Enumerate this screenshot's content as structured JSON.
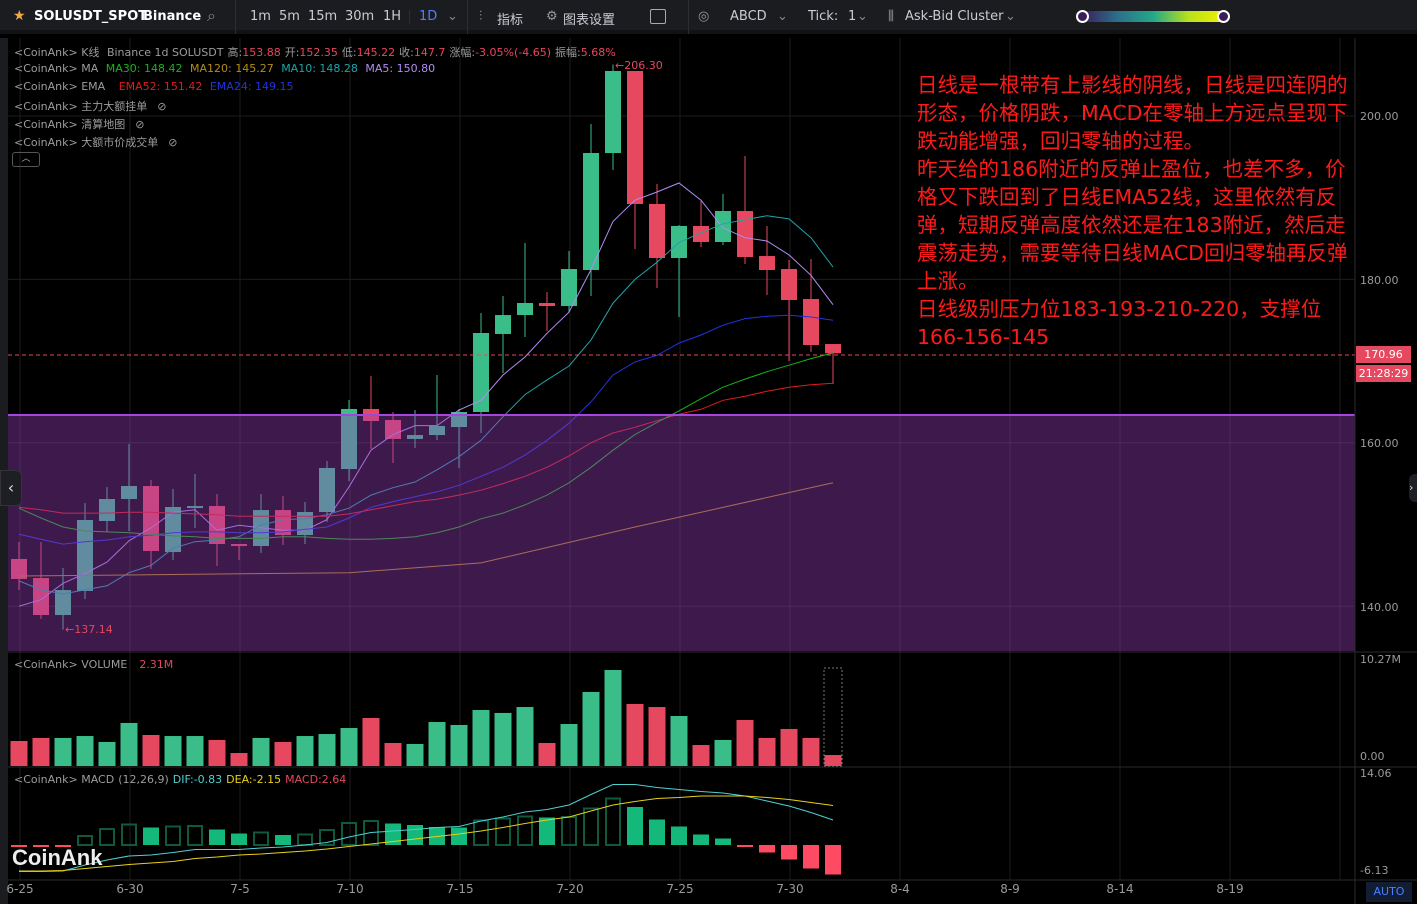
{
  "toolbar": {
    "symbol": "SOLUSDT_SPOT",
    "exchange": "Binance",
    "intervals": [
      "1m",
      "5m",
      "15m",
      "30m",
      "1H"
    ],
    "active_interval": "1D",
    "indicators_label": "指标",
    "chart_settings_label": "图表设置",
    "abcd_label": "ABCD",
    "tick_label": "Tick:",
    "tick_value": "1",
    "cluster_label": "Ask-Bid Cluster",
    "accent": "#4d7fff"
  },
  "legend": {
    "kline": {
      "prefix": "<CoinAnk> K线",
      "info": "Binance 1d SOLUSDT",
      "high_label": "高:",
      "high": "153.88",
      "open_label": "开:",
      "open": "152.35",
      "low_label": "低:",
      "low": "145.22",
      "close_label": "收:",
      "close": "147.7",
      "change_label": "涨幅:",
      "change": "-3.05%(-4.65)",
      "amplitude_label": "振幅:",
      "amplitude": "5.68%"
    },
    "ma": {
      "prefix": "<CoinAnk> MA",
      "items": [
        {
          "text": "MA30: 148.42",
          "color": "#17b417"
        },
        {
          "text": "MA120: 145.27",
          "color": "#b58b16"
        },
        {
          "text": "MA10: 148.28",
          "color": "#1fa3a8"
        },
        {
          "text": "MA5: 150.80",
          "color": "#b48cf2"
        }
      ]
    },
    "ema": {
      "prefix": "<CoinAnk> EMA",
      "items": [
        {
          "text": "EMA52: 151.42",
          "color": "#e21b1b"
        },
        {
          "text": "EMA24: 149.15",
          "color": "#2233e0"
        }
      ]
    },
    "hidden": [
      "<CoinAnk> 主力大额挂单",
      "<CoinAnk> 清算地图",
      "<CoinAnk> 大额市价成交单"
    ],
    "volume": {
      "prefix": "<CoinAnk> VOLUME",
      "value": "2.31M"
    },
    "macd": {
      "prefix": "<CoinAnk> MACD",
      "params": "(12,26,9)",
      "dif": "DIF:-0.83",
      "dea": "DEA:-2.15",
      "macd": "MACD:2.64"
    }
  },
  "axes": {
    "price_ticks": [
      "200.00",
      "180.00",
      "160.00",
      "140.00"
    ],
    "volume_ticks": [
      "10.27M",
      "0.00"
    ],
    "macd_ticks": [
      "14.06",
      "-6.13"
    ],
    "x_ticks": [
      "6-25",
      "6-30",
      "7-5",
      "7-10",
      "7-15",
      "7-20",
      "7-25",
      "7-30",
      "8-4",
      "8-9",
      "8-14",
      "8-19"
    ],
    "auto_label": "AUTO"
  },
  "current_price": "170.96",
  "countdown": "21:28:29",
  "markers": {
    "high": "←206.30",
    "low": "←137.14"
  },
  "watermark": "CoinAnk",
  "annotation": [
    "日线是一根带有上影线的阴线，日线是四连阴的",
    "形态，价格阴跌，MACD在零轴上方远点呈现下",
    "跌动能增强，回归零轴的过程。",
    "昨天给的186附近的反弹止盈位，也差不多，价",
    "格又下跌回到了日线EMA52线，这里依然有反",
    "弹，短期反弹高度依然还是在183附近，然后走",
    "震荡走势，需要等待日线MACD回归零轴再反弹",
    "上涨。",
    "日线级别压力位183-193-210-220，支撑位",
    "166-156-145"
  ],
  "colors": {
    "up": "#3bbd8a",
    "down": "#e5485f",
    "zone": "#a445e0",
    "note": "#ff1a1a"
  },
  "chart_data": {
    "type": "candlestick",
    "price_range": [
      136,
      208
    ],
    "zone": [
      137,
      164.5
    ],
    "candles": [
      [
        145.78,
        147.86,
        141.98,
        143.33
      ],
      [
        143.45,
        147.86,
        138.43,
        138.92
      ],
      [
        138.92,
        144.68,
        137.14,
        141.98
      ],
      [
        141.86,
        152.63,
        140.88,
        150.55
      ],
      [
        150.43,
        154.59,
        149.08,
        153.12
      ],
      [
        153.12,
        159.85,
        149.2,
        154.71
      ],
      [
        154.71,
        155.45,
        144.55,
        146.76
      ],
      [
        146.63,
        154.35,
        145.65,
        152.14
      ],
      [
        152.14,
        156.18,
        149.57,
        152.26
      ],
      [
        152.26,
        153.73,
        144.92,
        147.61
      ],
      [
        147.61,
        147.61,
        145.65,
        147.37
      ],
      [
        147.37,
        153.73,
        146.51,
        151.77
      ],
      [
        151.77,
        153.49,
        147.49,
        148.71
      ],
      [
        148.71,
        152.75,
        147.61,
        151.53
      ],
      [
        151.53,
        157.77,
        150.31,
        156.92
      ],
      [
        156.79,
        165.24,
        155.32,
        164.14
      ],
      [
        164.14,
        168.18,
        159.24,
        162.67
      ],
      [
        162.79,
        163.77,
        157.53,
        160.47
      ],
      [
        160.47,
        164.01,
        159.36,
        160.95
      ],
      [
        160.95,
        168.3,
        160.34,
        162.06
      ],
      [
        161.93,
        164.14,
        156.92,
        163.77
      ],
      [
        163.77,
        175.89,
        161.2,
        173.44
      ],
      [
        173.32,
        177.97,
        168.54,
        175.64
      ],
      [
        175.64,
        184.46,
        172.95,
        177.11
      ],
      [
        177.11,
        178.46,
        173.68,
        176.74
      ],
      [
        176.74,
        183.48,
        176.01,
        181.27
      ],
      [
        181.15,
        199.02,
        177.97,
        195.47
      ],
      [
        195.47,
        206.3,
        193.39,
        205.51
      ],
      [
        205.51,
        205.51,
        183.72,
        189.23
      ],
      [
        189.23,
        191.68,
        178.95,
        182.62
      ],
      [
        182.62,
        186.66,
        175.4,
        186.54
      ],
      [
        186.54,
        189.6,
        183.97,
        184.58
      ],
      [
        184.58,
        190.45,
        184.21,
        188.37
      ],
      [
        188.37,
        195.1,
        181.88,
        182.74
      ],
      [
        182.86,
        186.54,
        178.09,
        181.15
      ],
      [
        181.27,
        182.37,
        170.01,
        177.48
      ],
      [
        177.6,
        182.5,
        171.11,
        171.97
      ],
      [
        172.09,
        172.09,
        167.2,
        170.96
      ]
    ],
    "lines": [
      {
        "name": "MA5",
        "color": "#b48cf2",
        "values": [
          140.0,
          140.8,
          142.8,
          144.0,
          145.4,
          148.0,
          149.6,
          151.5,
          151.8,
          149.3,
          149.9,
          149.6,
          149.3,
          149.3,
          150.6,
          154.6,
          159.1,
          161.0,
          162.1,
          162.1,
          164.0,
          165.2,
          168.3,
          170.5,
          173.4,
          176.0,
          181.2,
          187.1,
          189.7,
          190.7,
          191.8,
          189.7,
          186.3,
          185.1,
          184.7,
          183.0,
          180.5,
          176.9
        ]
      },
      {
        "name": "MA10",
        "color": "#1fa3a8",
        "values": [
          143.1,
          142.0,
          141.5,
          142.0,
          142.5,
          144.1,
          145.0,
          147.1,
          147.9,
          148.1,
          148.5,
          149.9,
          150.6,
          150.7,
          151.2,
          152.0,
          153.6,
          154.5,
          155.2,
          156.7,
          158.3,
          160.3,
          163.2,
          165.9,
          167.7,
          169.4,
          172.6,
          177.1,
          180.0,
          182.1,
          184.5,
          185.7,
          186.8,
          187.3,
          187.8,
          187.4,
          185.1,
          181.5
        ]
      },
      {
        "name": "EMA24",
        "color": "#2233e0",
        "values": [
          148.8,
          148.2,
          147.6,
          147.9,
          148.1,
          148.5,
          148.7,
          149.0,
          149.1,
          149.1,
          149.0,
          149.0,
          149.1,
          149.4,
          149.7,
          150.8,
          152.1,
          152.8,
          153.4,
          154.0,
          154.8,
          155.9,
          157.0,
          158.5,
          160.3,
          162.4,
          165.0,
          168.3,
          169.9,
          170.7,
          172.2,
          173.2,
          174.4,
          175.2,
          175.5,
          175.6,
          175.4,
          175.0
        ]
      },
      {
        "name": "EMA52",
        "color": "#e21b1b",
        "values": [
          152.1,
          151.8,
          151.4,
          151.4,
          151.4,
          151.5,
          151.5,
          151.4,
          151.3,
          151.2,
          151.0,
          151.0,
          151.0,
          151.0,
          151.0,
          151.3,
          151.8,
          152.3,
          152.8,
          153.1,
          153.6,
          154.2,
          155.0,
          155.9,
          157.0,
          158.4,
          160.0,
          161.2,
          161.9,
          162.7,
          163.5,
          164.1,
          165.2,
          165.7,
          166.3,
          166.8,
          167.1,
          167.3
        ]
      },
      {
        "name": "MA30",
        "color": "#17b417",
        "values": [
          152.0,
          150.8,
          149.7,
          149.2,
          149.1,
          149.0,
          148.8,
          148.6,
          148.5,
          148.3,
          148.3,
          148.3,
          148.5,
          148.5,
          148.3,
          148.2,
          148.2,
          148.3,
          148.5,
          149.0,
          149.7,
          150.7,
          151.4,
          152.4,
          153.6,
          155.1,
          157.0,
          159.1,
          161.0,
          162.5,
          163.9,
          165.4,
          166.8,
          167.8,
          168.7,
          169.5,
          170.3,
          171.0
        ]
      },
      {
        "name": "MA120",
        "color": "#b58b16",
        "anchors": [
          [
            0,
            143.7
          ],
          [
            8,
            143.9
          ],
          [
            15,
            144.1
          ],
          [
            21,
            145.3
          ],
          [
            28,
            149.7
          ],
          [
            37,
            155.1
          ]
        ]
      }
    ],
    "volume_m": [
      2.62,
      2.94,
      2.94,
      3.14,
      2.52,
      4.51,
      3.25,
      3.14,
      3.14,
      2.73,
      1.36,
      2.94,
      2.52,
      3.14,
      3.35,
      3.98,
      5.03,
      2.41,
      2.31,
      4.61,
      4.3,
      5.87,
      5.56,
      6.18,
      2.41,
      4.4,
      7.76,
      10.06,
      6.5,
      6.18,
      5.24,
      2.2,
      2.73,
      4.82,
      2.94,
      3.88,
      2.94,
      1.15
    ],
    "volume_max_m": 10.27,
    "macd_hist": [
      -0.3,
      -0.3,
      -0.3,
      1.8,
      3.2,
      4.1,
      3.5,
      3.7,
      3.8,
      3.1,
      2.3,
      2.5,
      2.0,
      2.1,
      3.0,
      4.4,
      4.8,
      4.3,
      4.0,
      3.6,
      3.5,
      4.9,
      5.3,
      5.7,
      5.5,
      5.6,
      7.3,
      9.3,
      7.6,
      5.1,
      3.7,
      2.1,
      1.3,
      -0.2,
      -1.5,
      -2.9,
      -4.7,
      -5.9
    ],
    "dif": [
      -5.3,
      -5.3,
      -5.2,
      -4.0,
      -3.0,
      -2.2,
      -2.0,
      -1.5,
      -0.9,
      -0.9,
      -0.9,
      -0.6,
      -0.4,
      0.0,
      0.5,
      1.6,
      2.5,
      2.8,
      3.1,
      3.5,
      3.7,
      4.8,
      5.6,
      6.6,
      7.1,
      8.0,
      10.1,
      12.1,
      12.1,
      11.5,
      11.1,
      10.7,
      10.4,
      9.8,
      8.8,
      7.8,
      6.5,
      5.0
    ],
    "dea": [
      -5.2,
      -5.2,
      -5.1,
      -4.7,
      -4.3,
      -3.9,
      -3.6,
      -3.3,
      -2.7,
      -2.4,
      -2.0,
      -1.8,
      -1.5,
      -1.2,
      -0.8,
      -0.3,
      0.2,
      0.7,
      1.2,
      1.7,
      2.2,
      2.8,
      3.5,
      4.3,
      5.0,
      5.6,
      6.8,
      8.0,
      8.7,
      9.3,
      9.5,
      9.8,
      9.8,
      9.8,
      9.5,
      9.1,
      8.5,
      7.9
    ]
  }
}
